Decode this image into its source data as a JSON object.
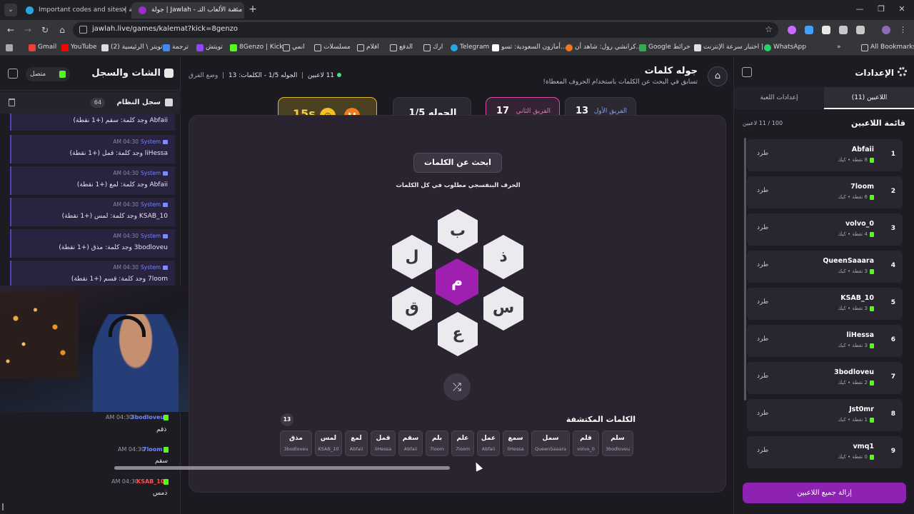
{
  "browser": {
    "tabs": [
      {
        "title": "Important codes and sites | جمعية",
        "active": false
      },
      {
        "title": "جولة | Jawlah - منصة الألعاب التـ",
        "active": true
      }
    ],
    "url": "jawlah.live/games/kalemat?kick=8genzo",
    "bookmarks": [
      "Gmail",
      "YouTube",
      "(2) تويتر \\ الرئيسية",
      "ترجمة",
      "تويتش",
      "8Genzo | Kick",
      "انمي",
      "مسلسلات",
      "افلام",
      "الدفع",
      "ارك",
      "Telegram",
      "أمازون السعودية: تسو...",
      "كرانشي رول: شاهد أن...",
      "Google خرائط",
      "اختبار سرعة الإنترنت |...",
      "WhatsApp",
      "All Bookmarks"
    ]
  },
  "chat": {
    "title": "الشات والسجل",
    "status": "متصل",
    "syslog_title": "سجل النظام",
    "syslog_count": "64",
    "system_messages": [
      {
        "who": "",
        "time": "",
        "text": "Abfaii وجد كلمة: سقم (+1 نقطة)"
      },
      {
        "who": "System",
        "time": "AM 04:30",
        "text": "liHessa وجد كلمة: قمل (+1 نقطة)"
      },
      {
        "who": "System",
        "time": "AM 04:30",
        "text": "Abfaii وجد كلمة: لمع (+1 نقطة)"
      },
      {
        "who": "System",
        "time": "AM 04:30",
        "text": "KSAB_10 وجد كلمة: لمس (+1 نقطة)"
      },
      {
        "who": "System",
        "time": "AM 04:30",
        "text": "3bodloveu وجد كلمة: مذق (+1 نقطة)"
      },
      {
        "who": "System",
        "time": "AM 04:30",
        "text": "7loom وجد كلمة: قسم (+1 نقطة)"
      }
    ],
    "messages": [
      {
        "name": "3bodloveu",
        "time": "AM 04:30",
        "text": "ذقم",
        "color": "#6f86ff"
      },
      {
        "name": "7loom",
        "time": "AM 04:30",
        "text": "سقم",
        "color": "#6f86ff"
      },
      {
        "name": "KSAB_10",
        "time": "AM 04:30",
        "text": "ذمس",
        "color": "#ff4f4f"
      }
    ]
  },
  "game": {
    "title": "جوله كلمات",
    "subtitle": "تسابق في البحث عن الكلمات باستخدام الحروف المعطاة!",
    "players_meta": "11 لاعبين",
    "round_meta": "الجوله 1/5 - الكلمات: 13",
    "mode_meta": "وضع الفرق",
    "team1": {
      "name": "الفريق الأول",
      "score": "13"
    },
    "team2": {
      "name": "الفريق الثاني",
      "score": "17"
    },
    "round": "الجوله 1/5",
    "timer": "15s",
    "search_label": "ابحث عن الكلمات",
    "hint": "الحرف البنفسجي مطلوب في كل الكلمات",
    "letters": {
      "center": "م",
      "top": "ب",
      "top_right": "ذ",
      "bottom_right": "س",
      "bottom": "ع",
      "bottom_left": "ق",
      "top_left": "ل"
    },
    "found_title": "الكلمات المكتشفة",
    "found_count": "13",
    "found_words": [
      {
        "word": "سلم",
        "by": "3bodloveu"
      },
      {
        "word": "قلم",
        "by": "volvo_0"
      },
      {
        "word": "سمل",
        "by": "QueenSaaara"
      },
      {
        "word": "سمع",
        "by": "liHessa"
      },
      {
        "word": "عمل",
        "by": "Abfaii"
      },
      {
        "word": "علم",
        "by": "7loom"
      },
      {
        "word": "بلم",
        "by": "7loom"
      },
      {
        "word": "سقم",
        "by": "Abfaii"
      },
      {
        "word": "قمل",
        "by": "liHessa"
      },
      {
        "word": "لمع",
        "by": "Abfaii"
      },
      {
        "word": "لمس",
        "by": "KSAB_10"
      },
      {
        "word": "مذق",
        "by": "3bodloveu"
      }
    ]
  },
  "settings": {
    "title": "الإعدادات",
    "tab_players": "اللاعبين (11)",
    "tab_game": "إعدادات اللعبة",
    "players_title": "قائمة اللاعبين",
    "players_count": "100 / 11 لاعبين",
    "kick_label": "طرد",
    "remove_all": "إزالة جميع اللاعبين",
    "players": [
      {
        "num": "1",
        "name": "Abfaii",
        "pts": "8 نقطة • كيك"
      },
      {
        "num": "2",
        "name": "7loom",
        "pts": "6 نقطة • كيك"
      },
      {
        "num": "3",
        "name": "volvo_0",
        "pts": "4 نقطة • كيك"
      },
      {
        "num": "4",
        "name": "QueenSaaara",
        "pts": "3 نقطة • كيك"
      },
      {
        "num": "5",
        "name": "KSAB_10",
        "pts": "3 نقطة • كيك"
      },
      {
        "num": "6",
        "name": "liHessa",
        "pts": "3 نقطة • كيك"
      },
      {
        "num": "7",
        "name": "3bodloveu",
        "pts": "2 نقطة • كيك"
      },
      {
        "num": "8",
        "name": "Jst0mr",
        "pts": "1 نقطة • كيك"
      },
      {
        "num": "9",
        "name": "vmq1",
        "pts": "0 نقطة • كيك"
      }
    ]
  }
}
